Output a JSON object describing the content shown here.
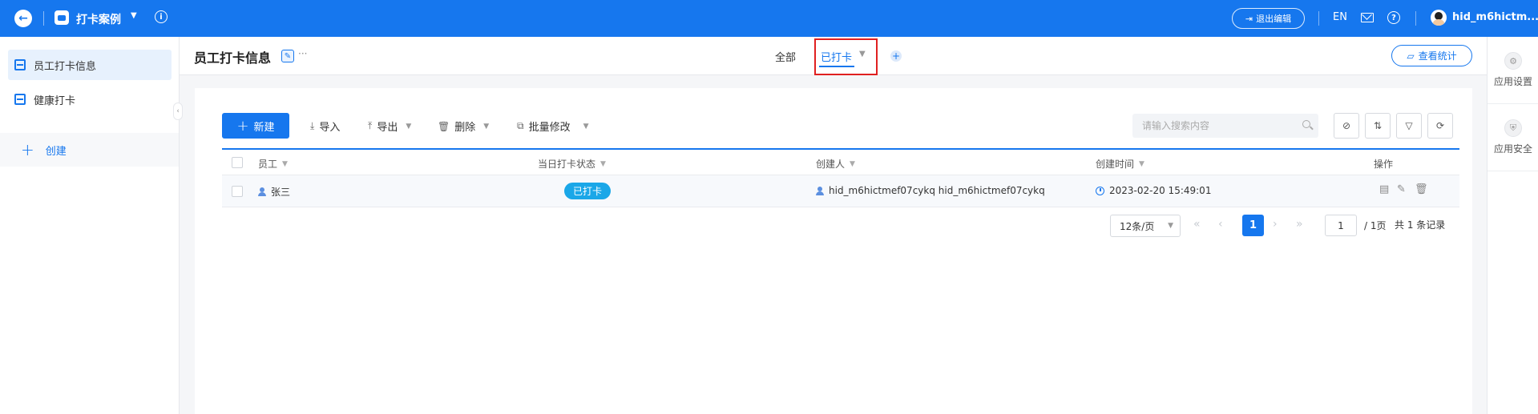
{
  "topbar": {
    "app_title": "打卡案例",
    "exit_edit_label": "退出编辑",
    "language": "EN",
    "username": "hid_m6hictm..."
  },
  "sidebar": {
    "items": [
      {
        "label": "员工打卡信息"
      },
      {
        "label": "健康打卡"
      }
    ],
    "create_label": "创建"
  },
  "rightbar": {
    "items": [
      {
        "label": "应用设置"
      },
      {
        "label": "应用安全"
      }
    ]
  },
  "header": {
    "title": "员工打卡信息",
    "more": "···",
    "tab_all": "全部",
    "tab_active": "已打卡",
    "stats_label": "查看统计"
  },
  "toolbar": {
    "new_label": "新建",
    "import_label": "导入",
    "export_label": "导出",
    "delete_label": "删除",
    "batch_edit_label": "批量修改",
    "search_placeholder": "请输入搜索内容"
  },
  "table": {
    "columns": [
      "员工",
      "当日打卡状态",
      "创建人",
      "创建时间",
      "操作"
    ],
    "rows": [
      {
        "employee": "张三",
        "status": "已打卡",
        "creator": "hid_m6hictmef07cykq hid_m6hictmef07cykq",
        "created_at": "2023-02-20 15:49:01"
      }
    ]
  },
  "pagination": {
    "page_size": "12条/页",
    "current_page": "1",
    "jump_value": "1",
    "total_pages": "/ 1页",
    "total_records": "共 1 条记录"
  },
  "colors": {
    "primary": "#1677ee",
    "highlight_border": "#e02020",
    "status_badge": "#1aa7e8"
  }
}
